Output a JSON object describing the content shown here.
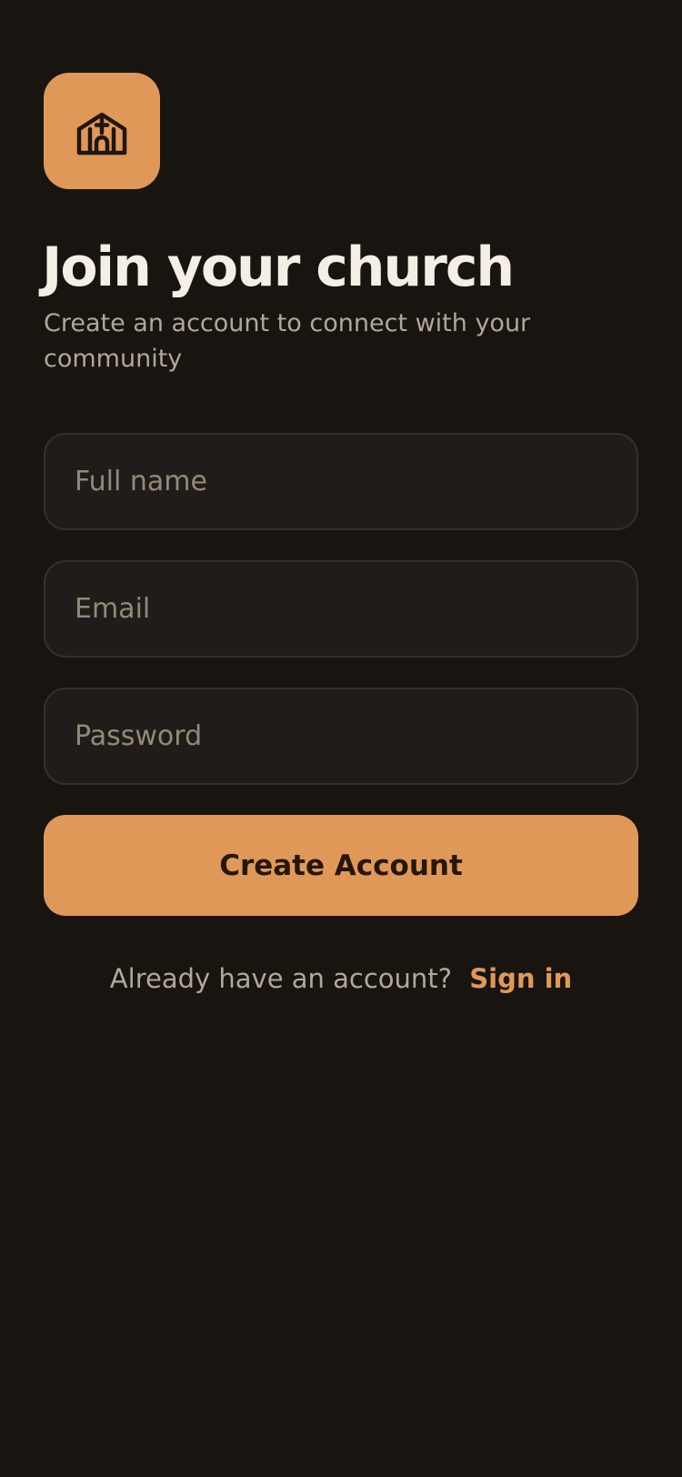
{
  "logo": {
    "icon": "church-icon",
    "background": "#E09858"
  },
  "header": {
    "title": "Join your church",
    "subtitle": "Create an account to connect with your community"
  },
  "form": {
    "full_name": {
      "placeholder": "Full name",
      "value": ""
    },
    "email": {
      "placeholder": "Email",
      "value": ""
    },
    "password": {
      "placeholder": "Password",
      "value": ""
    },
    "submit_label": "Create Account"
  },
  "footer": {
    "prompt": "Already have an account?",
    "link_label": "Sign in"
  },
  "colors": {
    "background": "#181410",
    "accent": "#E09858",
    "title_text": "#F5EEE4",
    "muted_text": "#B2A797",
    "field_background": "#201C19",
    "field_border": "#34302C"
  }
}
